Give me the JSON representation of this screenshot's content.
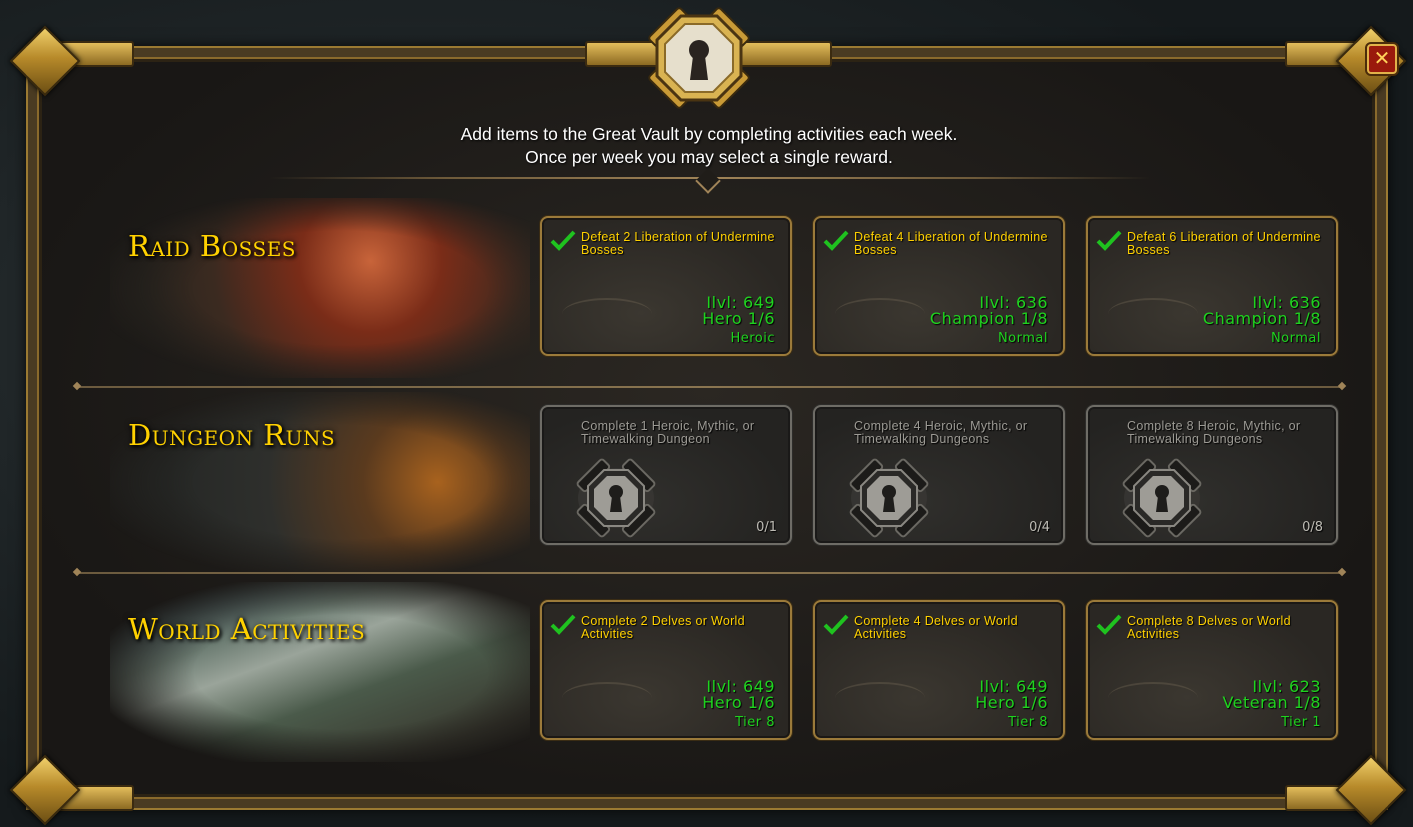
{
  "window": {
    "close_icon": "close-icon",
    "emblem_icon": "keyhole-lock-icon"
  },
  "header": {
    "line1": "Add items to the Great Vault by completing activities each week.",
    "line2": "Once per week you may select a single reward."
  },
  "colors": {
    "title_gold": "#ffd100",
    "reward_green": "#1fd21f",
    "locked_gray": "#9c9a94",
    "frame_gold": "#9b7a3a"
  },
  "rows": [
    {
      "title": "Raid Bosses",
      "cards": [
        {
          "desc": "Defeat 2 Liberation of Undermine Bosses",
          "ilvl": "Ilvl: 649",
          "track": "Hero 1/6",
          "difficulty": "Heroic",
          "unlocked": true
        },
        {
          "desc": "Defeat 4 Liberation of Undermine Bosses",
          "ilvl": "Ilvl: 636",
          "track": "Champion 1/8",
          "difficulty": "Normal",
          "unlocked": true
        },
        {
          "desc": "Defeat 6 Liberation of Undermine Bosses",
          "ilvl": "Ilvl: 636",
          "track": "Champion 1/8",
          "difficulty": "Normal",
          "unlocked": true
        }
      ]
    },
    {
      "title": "Dungeon Runs",
      "cards": [
        {
          "desc": "Complete 1 Heroic, Mythic, or Timewalking Dungeon",
          "progress": "0/1",
          "unlocked": false
        },
        {
          "desc": "Complete 4 Heroic, Mythic, or Timewalking Dungeons",
          "progress": "0/4",
          "unlocked": false
        },
        {
          "desc": "Complete 8 Heroic, Mythic, or Timewalking Dungeons",
          "progress": "0/8",
          "unlocked": false
        }
      ]
    },
    {
      "title": "World Activities",
      "cards": [
        {
          "desc": "Complete 2 Delves or World Activities",
          "ilvl": "Ilvl: 649",
          "track": "Hero 1/6",
          "difficulty": "Tier 8",
          "unlocked": true
        },
        {
          "desc": "Complete 4 Delves or World Activities",
          "ilvl": "Ilvl: 649",
          "track": "Hero 1/6",
          "difficulty": "Tier 8",
          "unlocked": true
        },
        {
          "desc": "Complete 8 Delves or World Activities",
          "ilvl": "Ilvl: 623",
          "track": "Veteran 1/8",
          "difficulty": "Tier 1",
          "unlocked": true
        }
      ]
    }
  ]
}
